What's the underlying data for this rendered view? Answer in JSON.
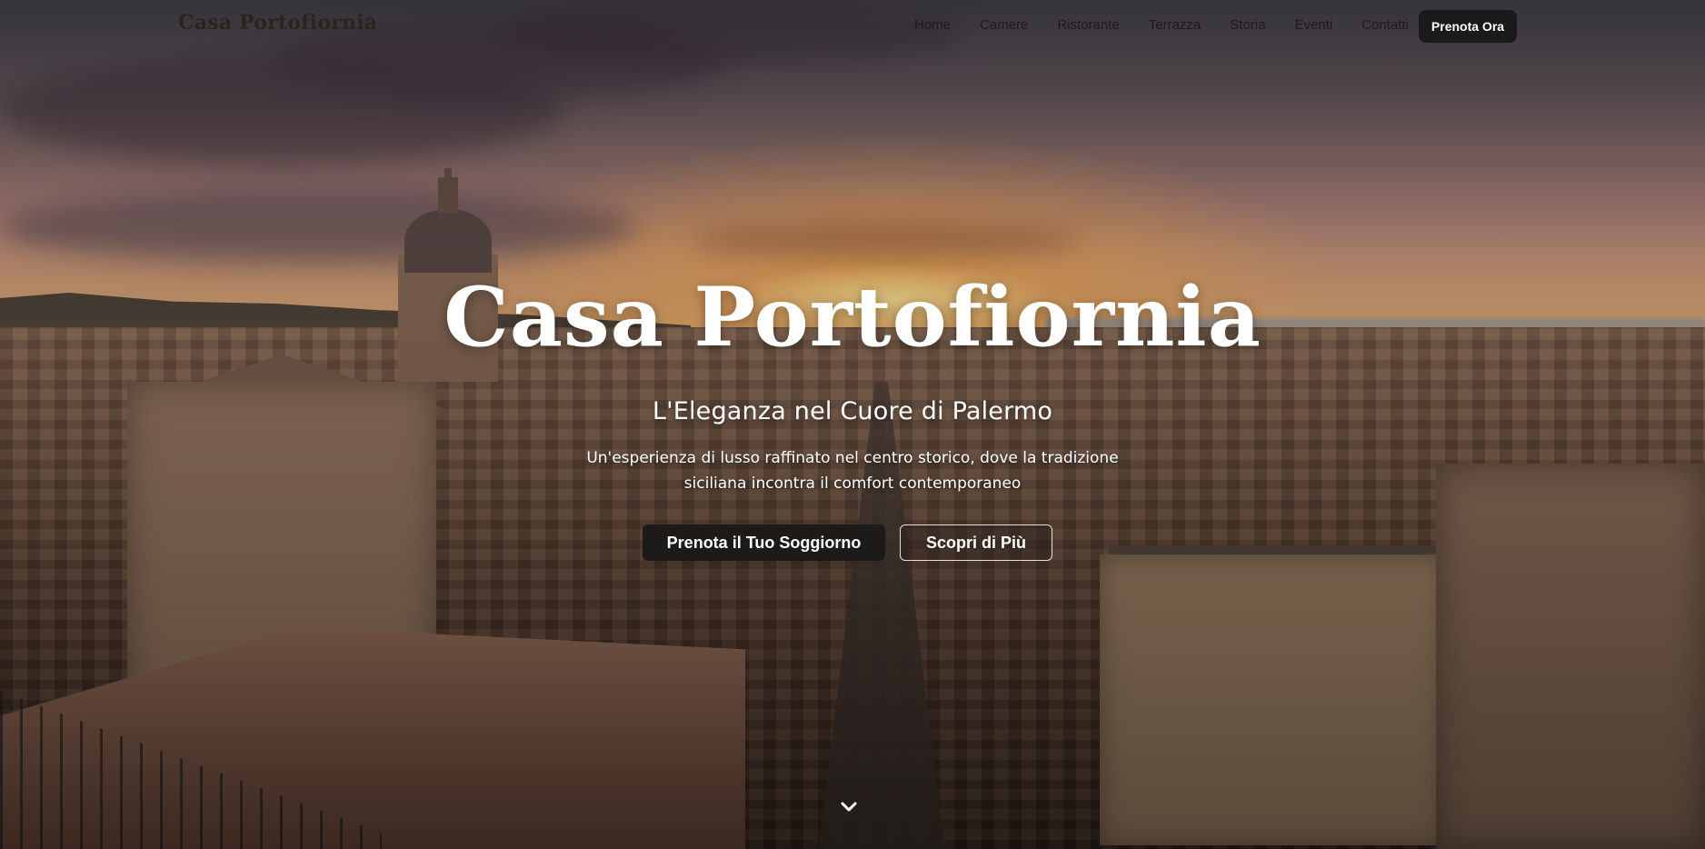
{
  "nav": {
    "brand": "Casa Portofiornia",
    "items": [
      "Home",
      "Camere",
      "Ristorante",
      "Terrazza",
      "Storia",
      "Eventi",
      "Contatti"
    ],
    "cta_label": "Prenota Ora"
  },
  "hero": {
    "title": "Casa Portofiornia",
    "subtitle": "L'Eleganza nel Cuore di Palermo",
    "description": "Un'esperienza di lusso raffinato nel centro storico, dove la tradizione siciliana incontra il comfort contemporaneo",
    "primary_button": "Prenota il Tuo Soggiorno",
    "secondary_button": "Scopri di Più",
    "scroll_icon": "chevron-down-icon"
  },
  "colors": {
    "button_dark": "#1a1a1a",
    "text_light": "#ffffff",
    "nav_text": "#1f1a18"
  }
}
